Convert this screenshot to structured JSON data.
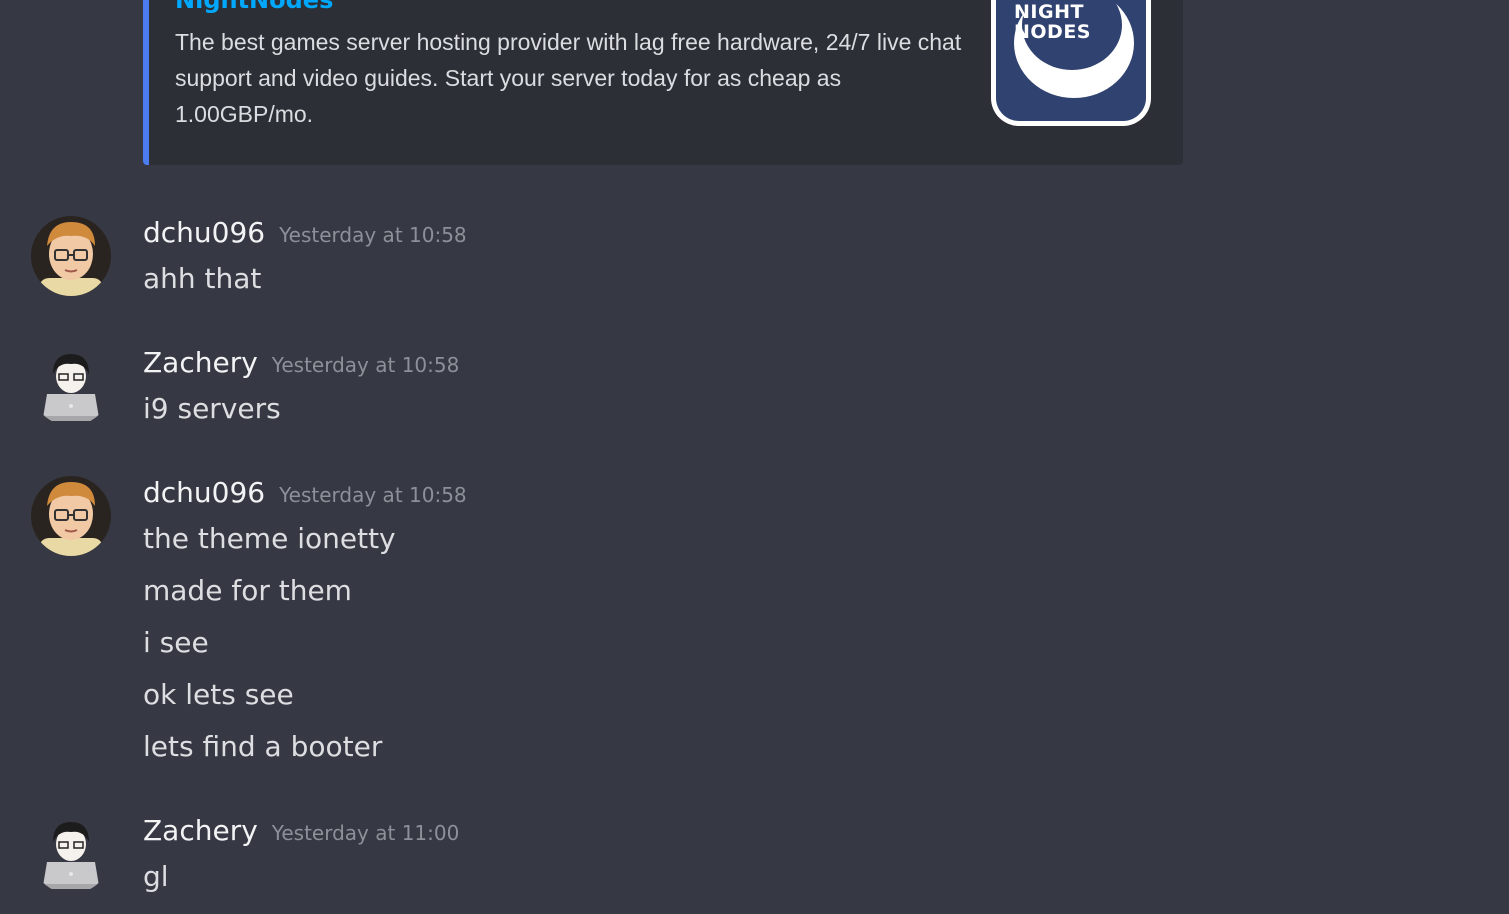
{
  "embed": {
    "title": "NightNodes",
    "description": "The best games server hosting provider with lag free hardware, 24/7 live chat support and video guides. Start your server today for as cheap as 1.00GBP/mo.",
    "thumbnail_line1": "NIGHT",
    "thumbnail_line2": "NODES",
    "accent_color": "#4c7df0"
  },
  "messages": [
    {
      "username": "dchu096",
      "timestamp": "Yesterday at 10:58",
      "avatar": "cartoon-boy-glasses-avatar",
      "lines": [
        "ahh that"
      ]
    },
    {
      "username": "Zachery",
      "timestamp": "Yesterday at 10:58",
      "avatar": "person-laptop-emoji-avatar",
      "lines": [
        "i9 servers"
      ]
    },
    {
      "username": "dchu096",
      "timestamp": "Yesterday at 10:58",
      "avatar": "cartoon-boy-glasses-avatar",
      "lines": [
        "the theme ionetty",
        "made for them",
        "i see",
        "ok lets see",
        "lets find a booter"
      ]
    },
    {
      "username": "Zachery",
      "timestamp": "Yesterday at 11:00",
      "avatar": "person-laptop-emoji-avatar",
      "lines": [
        "gl"
      ]
    }
  ],
  "colors": {
    "background": "#363943",
    "embed_background": "#2c2f36",
    "username": "#f2f3f5",
    "timestamp": "#8b9099"
  }
}
